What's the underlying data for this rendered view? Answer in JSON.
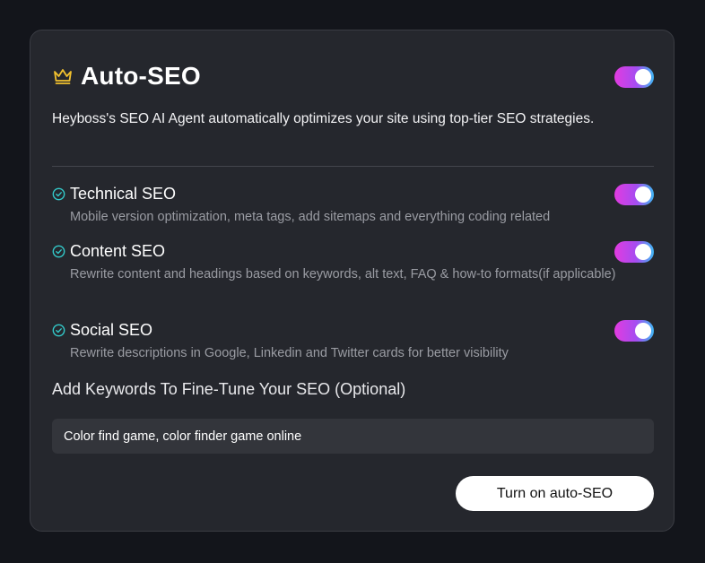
{
  "panel": {
    "title": "Auto-SEO",
    "title_icon": "crown-icon",
    "enabled": true,
    "description": "Heyboss's SEO AI Agent automatically optimizes your site using top-tier SEO strategies."
  },
  "features": [
    {
      "icon": "check-circle-icon",
      "label": "Technical SEO",
      "description": "Mobile version optimization, meta tags, add sitemaps and everything coding related",
      "enabled": true
    },
    {
      "icon": "check-circle-icon",
      "label": "Content SEO",
      "description": "Rewrite content and headings based on keywords, alt text, FAQ & how-to formats(if applicable)",
      "enabled": true
    },
    {
      "icon": "check-circle-icon",
      "label": "Social SEO",
      "description": "Rewrite descriptions in Google, Linkedin and Twitter cards for better visibility",
      "enabled": true
    }
  ],
  "keywords": {
    "label": "Add Keywords To Fine-Tune Your SEO (Optional)",
    "value": "Color find game, color finder game online"
  },
  "cta": {
    "label": "Turn on auto-SEO"
  },
  "colors": {
    "background": "#13151b",
    "card": "#25272d",
    "accent_gold": "#f2c12e",
    "check_teal": "#33c9c9",
    "toggle_gradient": [
      "#e23be0",
      "#a64cf0",
      "#3fb7f5"
    ]
  }
}
